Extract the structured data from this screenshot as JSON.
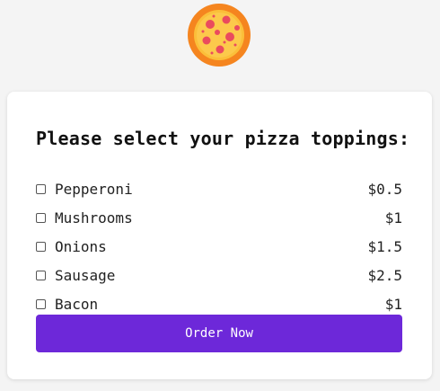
{
  "header": {
    "logo_icon": "pizza-icon"
  },
  "form": {
    "title": "Please select your pizza toppings:",
    "toppings": [
      {
        "label": "Pepperoni",
        "price": "$0.5"
      },
      {
        "label": "Mushrooms",
        "price": "$1"
      },
      {
        "label": "Onions",
        "price": "$1.5"
      },
      {
        "label": "Sausage",
        "price": "$2.5"
      },
      {
        "label": "Bacon",
        "price": "$1"
      }
    ],
    "order_button_label": "Order Now"
  },
  "colors": {
    "accent": "#6d28d9",
    "background": "#f4f4f4",
    "card": "#ffffff"
  }
}
